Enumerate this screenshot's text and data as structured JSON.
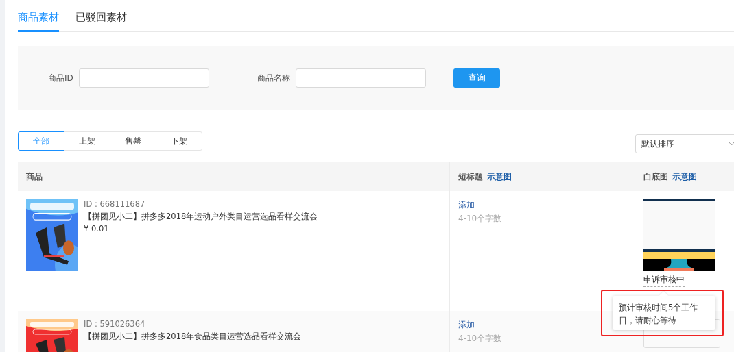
{
  "tabs": [
    {
      "label": "商品素材",
      "selected": true
    },
    {
      "label": "已驳回素材",
      "selected": false
    }
  ],
  "filters": [
    {
      "label": "商品ID"
    },
    {
      "label": "商品名称"
    }
  ],
  "query_button": "查询",
  "status_filters": [
    {
      "label": "全部",
      "selected": true
    },
    {
      "label": "上架",
      "selected": false
    },
    {
      "label": "售罄",
      "selected": false
    },
    {
      "label": "下架",
      "selected": false
    }
  ],
  "sort_select": {
    "value": "默认排序"
  },
  "table": {
    "columns": [
      {
        "label": "商品"
      },
      {
        "label": "短标题",
        "link": "示意图"
      },
      {
        "label": "白底图",
        "link": "示意图"
      }
    ],
    "rows": [
      {
        "product_id": "ID : 668111687",
        "title": "【拼团见小二】拼多多2018年运动户外类目运营选品看样交流会",
        "price": "¥  0.01",
        "short_title_action": "添加",
        "short_title_hint": "4-10个字数",
        "white_image": {
          "kind": "picture",
          "status": "申诉审核中"
        }
      },
      {
        "product_id": "ID : 591026364",
        "title": "【拼团见小二】拼多多2018年食品类目运营选品看样交流会",
        "short_title_action": "添加",
        "short_title_hint": "4-10个字数",
        "white_image": {
          "kind": "empty"
        }
      }
    ]
  },
  "tooltip": {
    "text": "预计审核时间5个工作日，请耐心等待",
    "highlighted": true
  }
}
